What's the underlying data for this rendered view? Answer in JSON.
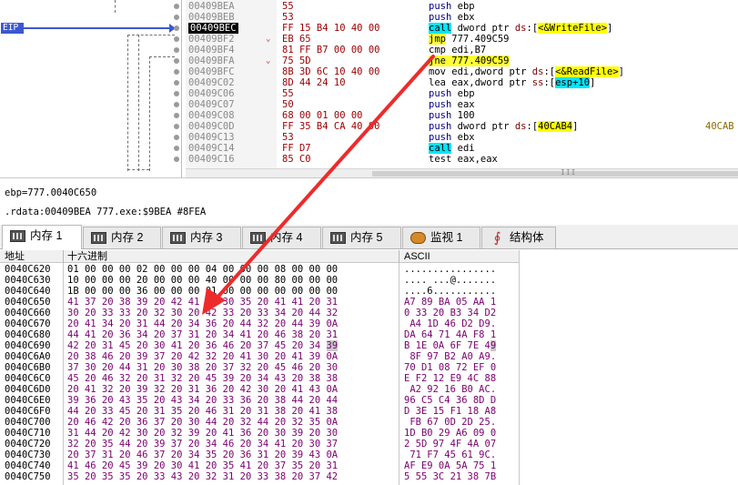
{
  "registers": {
    "eip_label": "EIP"
  },
  "disassembly": [
    {
      "addr": "00409BEA",
      "bytes": "55",
      "asm_parts": [
        [
          "push",
          "kw-push"
        ],
        [
          " ebp",
          "reg"
        ]
      ],
      "jmp": ""
    },
    {
      "addr": "00409BEB",
      "bytes": "53",
      "asm_parts": [
        [
          "push",
          "kw-push"
        ],
        [
          " ebx",
          "reg"
        ]
      ],
      "jmp": ""
    },
    {
      "addr": "00409BEC",
      "bytes": "FF 15 B4 10 40 00",
      "asm_parts": [
        [
          "call",
          "kw-call"
        ],
        [
          " dword ptr ",
          "reg"
        ],
        [
          "ds",
          "seg"
        ],
        [
          ":[",
          "reg"
        ],
        [
          "<&WriteFile>",
          "ptrgt"
        ],
        [
          "]",
          "reg"
        ]
      ],
      "jmp": "",
      "current": true
    },
    {
      "addr": "00409BF2",
      "bytes": "EB 65",
      "asm_parts": [
        [
          "jmp",
          "kw-jmp"
        ],
        [
          " 777.409C59",
          "reg"
        ]
      ],
      "jmp": "⌄"
    },
    {
      "addr": "00409BF4",
      "bytes": "81 FF B7 00 00 00",
      "asm_parts": [
        [
          "cmp",
          "reg"
        ],
        [
          " edi,B7",
          "reg"
        ]
      ],
      "jmp": ""
    },
    {
      "addr": "00409BFA",
      "bytes": "75 5D",
      "asm_parts": [
        [
          "jne",
          "kw-jmp"
        ],
        [
          " 777.409C59",
          "kw-jmp"
        ]
      ],
      "jmp": "⌄"
    },
    {
      "addr": "00409BFC",
      "bytes": "8B 3D 6C 10 40 00",
      "asm_parts": [
        [
          "mov",
          "reg"
        ],
        [
          " edi,dword ptr ",
          "reg"
        ],
        [
          "ds",
          "seg"
        ],
        [
          ":[",
          "reg"
        ],
        [
          "<&ReadFile>",
          "ptrgt"
        ],
        [
          "]",
          "reg"
        ]
      ],
      "jmp": ""
    },
    {
      "addr": "00409C02",
      "bytes": "8D 44 24 10",
      "asm_parts": [
        [
          "lea",
          "reg"
        ],
        [
          " eax,dword ptr ",
          "reg"
        ],
        [
          "ss",
          "seg"
        ],
        [
          ":[",
          "reg"
        ],
        [
          "esp+10",
          "kw-call"
        ],
        [
          "]",
          "reg"
        ]
      ],
      "jmp": ""
    },
    {
      "addr": "00409C06",
      "bytes": "55",
      "asm_parts": [
        [
          "push",
          "kw-push"
        ],
        [
          " ebp",
          "reg"
        ]
      ],
      "jmp": ""
    },
    {
      "addr": "00409C07",
      "bytes": "50",
      "asm_parts": [
        [
          "push",
          "kw-push"
        ],
        [
          " eax",
          "reg"
        ]
      ],
      "jmp": ""
    },
    {
      "addr": "00409C08",
      "bytes": "68 00 01 00 00",
      "asm_parts": [
        [
          "push",
          "kw-push"
        ],
        [
          " 100",
          "reg"
        ]
      ],
      "jmp": ""
    },
    {
      "addr": "00409C0D",
      "bytes": "FF 35 B4 CA 40 00",
      "asm_parts": [
        [
          "push",
          "kw-push"
        ],
        [
          " dword ptr ",
          "reg"
        ],
        [
          "ds",
          "seg"
        ],
        [
          ":[",
          "reg"
        ],
        [
          "40CAB4",
          "ptrgt"
        ],
        [
          "]",
          "reg"
        ]
      ],
      "jmp": "",
      "extra": "40CAB"
    },
    {
      "addr": "00409C13",
      "bytes": "53",
      "asm_parts": [
        [
          "push",
          "kw-push"
        ],
        [
          " ebx",
          "reg"
        ]
      ],
      "jmp": ""
    },
    {
      "addr": "00409C14",
      "bytes": "FF D7",
      "asm_parts": [
        [
          "call",
          "kw-call"
        ],
        [
          " edi",
          "reg"
        ]
      ],
      "jmp": ""
    },
    {
      "addr": "00409C16",
      "bytes": "85 C0",
      "asm_parts": [
        [
          "test",
          "reg"
        ],
        [
          " eax,eax",
          "reg"
        ]
      ],
      "jmp": ""
    }
  ],
  "info": {
    "line1": "ebp=777.0040C650",
    "line2": ".rdata:00409BEA 777.exe:$9BEA #8FEA"
  },
  "tabs": [
    {
      "label": "内存 1",
      "icon": "memory-icon",
      "active": true
    },
    {
      "label": "内存 2",
      "icon": "memory-icon"
    },
    {
      "label": "内存 3",
      "icon": "memory-icon"
    },
    {
      "label": "内存 4",
      "icon": "memory-icon"
    },
    {
      "label": "内存 5",
      "icon": "memory-icon"
    },
    {
      "label": "监视 1",
      "icon": "watch-icon"
    },
    {
      "label": "结构体",
      "icon": "struct-icon"
    }
  ],
  "dump": {
    "headers": {
      "address": "地址",
      "hex": "十六进制",
      "ascii": "ASCII"
    },
    "rows": [
      {
        "addr": "0040C620",
        "hex": "01 00 00 00 02 00 00 00 04 00 00 00 08 00 00 00",
        "ascii": "................",
        "black": true
      },
      {
        "addr": "0040C630",
        "hex": "10 00 00 00 20 00 00 00 40 00 00 00 80 00 00 00",
        "ascii": ".... ...@.......",
        "black": true
      },
      {
        "addr": "0040C640",
        "hex": "1B 00 00 00 36 00 00 00 01 00 00 00 00 00 00 00",
        "ascii": "....6...........",
        "black": true
      },
      {
        "addr": "0040C650",
        "hex": "41 37 20 38 39 20 42 41 20 30 35 20 41 41 20 31",
        "ascii": "A7 89 BA 05 AA 1"
      },
      {
        "addr": "0040C660",
        "hex": "30 20 33 33 20 32 30 20 42 33 20 33 34 20 44 32",
        "ascii": "0 33 20 B3 34 D2"
      },
      {
        "addr": "0040C670",
        "hex": "20 41 34 20 31 44 20 34 36 20 44 32 20 44 39 0A",
        "ascii": " A4 1D 46 D2 D9."
      },
      {
        "addr": "0040C680",
        "hex": "44 41 20 36 34 20 37 31 20 34 41 20 46 38 20 31",
        "ascii": "DA 64 71 4A F8 1"
      },
      {
        "addr": "0040C690",
        "hex": "42 20 31 45 20 30 41 20 36 46 20 37 45 20 34 39",
        "ascii": "B 1E 0A 6F 7E 49",
        "hl": true
      },
      {
        "addr": "0040C6A0",
        "hex": "20 38 46 20 39 37 20 42 32 20 41 30 20 41 39 0A",
        "ascii": " 8F 97 B2 A0 A9."
      },
      {
        "addr": "0040C6B0",
        "hex": "37 30 20 44 31 20 30 38 20 37 32 20 45 46 20 30",
        "ascii": "70 D1 08 72 EF 0"
      },
      {
        "addr": "0040C6C0",
        "hex": "45 20 46 32 20 31 32 20 45 39 20 34 43 20 38 38",
        "ascii": "E F2 12 E9 4C 88"
      },
      {
        "addr": "0040C6D0",
        "hex": "20 41 32 20 39 32 20 31 36 20 42 30 20 41 43 0A",
        "ascii": " A2 92 16 B0 AC."
      },
      {
        "addr": "0040C6E0",
        "hex": "39 36 20 43 35 20 43 34 20 33 36 20 38 44 20 44",
        "ascii": "96 C5 C4 36 8D D"
      },
      {
        "addr": "0040C6F0",
        "hex": "44 20 33 45 20 31 35 20 46 31 20 31 38 20 41 38",
        "ascii": "D 3E 15 F1 18 A8"
      },
      {
        "addr": "0040C700",
        "hex": "20 46 42 20 36 37 20 30 44 20 32 44 20 32 35 0A",
        "ascii": " FB 67 0D 2D 25."
      },
      {
        "addr": "0040C710",
        "hex": "31 44 20 42 30 20 32 39 20 41 36 20 30 39 20 30",
        "ascii": "1D B0 29 A6 09 0"
      },
      {
        "addr": "0040C720",
        "hex": "32 20 35 44 20 39 37 20 34 46 20 34 41 20 30 37",
        "ascii": "2 5D 97 4F 4A 07"
      },
      {
        "addr": "0040C730",
        "hex": "20 37 31 20 46 37 20 34 35 20 36 31 20 39 43 0A",
        "ascii": " 71 F7 45 61 9C."
      },
      {
        "addr": "0040C740",
        "hex": "41 46 20 45 39 20 30 41 20 35 41 20 37 35 20 31",
        "ascii": "AF E9 0A 5A 75 1"
      },
      {
        "addr": "0040C750",
        "hex": "35 20 35 35 20 33 43 20 32 31 20 33 38 20 37 42",
        "ascii": "5 55 3C 21 38 7B"
      }
    ]
  },
  "scroll_grip": "III",
  "colors": {
    "eip": "#3d57d1",
    "annotation_arrow": "#ee2b2b",
    "hex_text": "#7a0070"
  }
}
